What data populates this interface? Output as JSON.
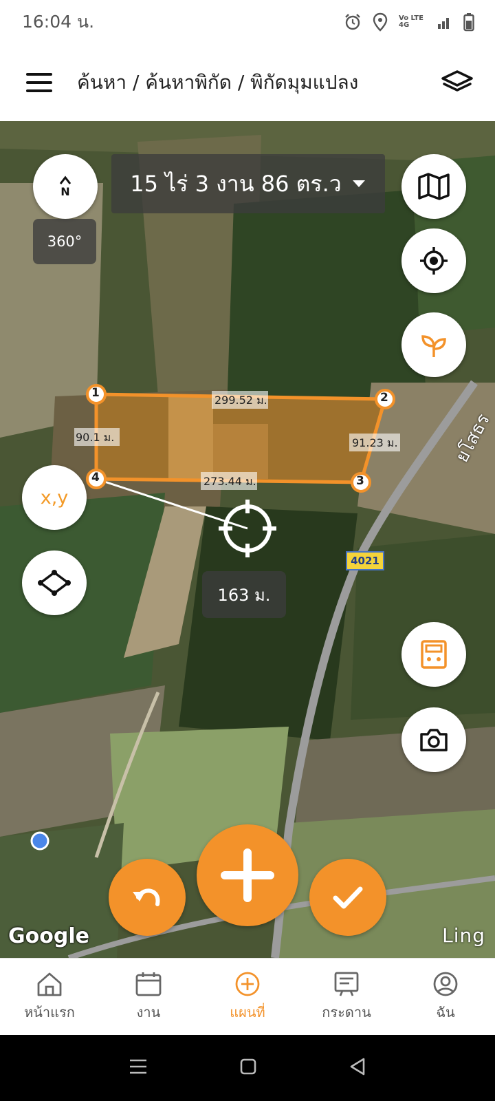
{
  "status_bar": {
    "time": "16:04 น.",
    "network_label": "Vo LTE 4G"
  },
  "header": {
    "breadcrumb": "ค้นหา / ค้นหาพิกัด / พิกัดมุมแปลง"
  },
  "map": {
    "area_text": "15 ไร่ 3 งาน 86 ตร.ว",
    "compass_letter": "N",
    "compass_angle": "360°",
    "xy_label": "x,y",
    "distance_to_target": "163 ม.",
    "road_number": "4021",
    "road_name": "ยโสธร",
    "brand": "Google",
    "attribution": "Ling",
    "plot": {
      "points": [
        "1",
        "2",
        "3",
        "4"
      ],
      "edges": {
        "top": "299.52 ม.",
        "right": "91.23 ม.",
        "bottom": "273.44 ม.",
        "left": "90.1 ม."
      }
    }
  },
  "colors": {
    "accent": "#f3922a",
    "plot_fill": "#c78a2e",
    "shield": "#f4d33b"
  },
  "bottom_nav": {
    "items": [
      {
        "label": "หน้าแรก",
        "icon": "home-icon"
      },
      {
        "label": "งาน",
        "icon": "calendar-icon"
      },
      {
        "label": "แผนที่",
        "icon": "add-circle-icon",
        "active": true
      },
      {
        "label": "กระดาน",
        "icon": "board-icon"
      },
      {
        "label": "ฉัน",
        "icon": "profile-icon"
      }
    ]
  }
}
